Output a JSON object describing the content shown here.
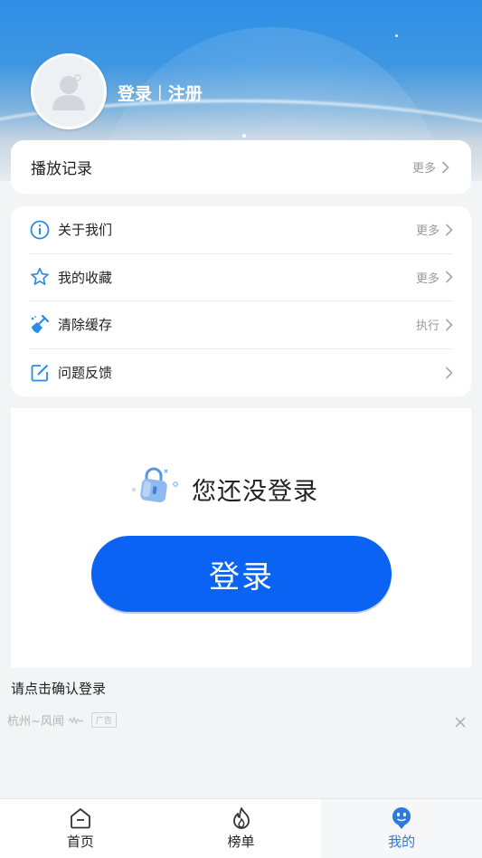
{
  "header": {
    "login_label": "登录",
    "separator": "|",
    "register_label": "注册"
  },
  "history": {
    "title": "播放记录",
    "more_label": "更多"
  },
  "menu": {
    "items": [
      {
        "label": "关于我们",
        "action": "更多",
        "icon": "info-icon"
      },
      {
        "label": "我的收藏",
        "action": "更多",
        "icon": "star-icon"
      },
      {
        "label": "清除缓存",
        "action": "执行",
        "icon": "broom-icon"
      },
      {
        "label": "问题反馈",
        "action": "",
        "icon": "edit-icon"
      }
    ]
  },
  "login_panel": {
    "hint": "您还没登录",
    "button_label": "登录"
  },
  "confirm_text": "请点击确认登录",
  "ad": {
    "text": "杭州~风闻",
    "badge": "广告"
  },
  "bottom_nav": {
    "items": [
      {
        "label": "首页",
        "icon": "home-icon",
        "active": false
      },
      {
        "label": "榜单",
        "icon": "flame-icon",
        "active": false
      },
      {
        "label": "我的",
        "icon": "profile-icon",
        "active": true
      }
    ]
  },
  "colors": {
    "accent": "#0a63f2",
    "nav_active": "#2a7ae2",
    "header_top": "#2f8fe6"
  }
}
